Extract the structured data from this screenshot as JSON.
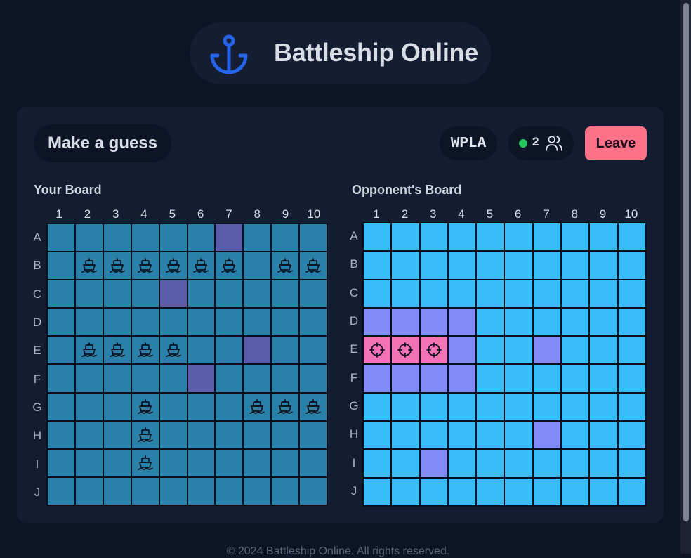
{
  "app": {
    "title": "Battleship Online",
    "logo_icon": "anchor-icon"
  },
  "toolbar": {
    "guess_label": "Make a guess",
    "game_code": "WPLA",
    "player_count": "2",
    "status_dot_color": "#22c55e",
    "players_icon": "users-icon",
    "leave_label": "Leave"
  },
  "boards": {
    "columns": [
      "1",
      "2",
      "3",
      "4",
      "5",
      "6",
      "7",
      "8",
      "9",
      "10"
    ],
    "rows": [
      "A",
      "B",
      "C",
      "D",
      "E",
      "F",
      "G",
      "H",
      "I",
      "J"
    ],
    "own": {
      "title": "Your Board",
      "cells": [
        "wwwwwwmwww",
        "wsssssswss",
        "wwwwmwwwww",
        "wwwwwwwwww",
        "wsssswwmww",
        "wwwwwmwwww",
        "wwwswwwsss",
        "wwwswwwwww",
        "wwwswwwwww",
        "wwwwwwwwww"
      ]
    },
    "opponent": {
      "title": "Opponent's Board",
      "cells": [
        "..........",
        "..........",
        "..........",
        "mmmm......",
        "hhhm..m...",
        "mmmm......",
        "..........",
        "......m...",
        "..m.......",
        ".........."
      ]
    },
    "legend_colors": {
      "own_water": "#2980a8",
      "own_miss": "#5a5cab",
      "opp_unknown": "#38bdf8",
      "opp_miss": "#818cf8",
      "opp_hit": "#f472b6"
    },
    "icons": {
      "ship": "ship-icon",
      "hit": "crosshair-icon"
    }
  },
  "footer": {
    "text": "© 2024 Battleship Online. All rights reserved."
  }
}
